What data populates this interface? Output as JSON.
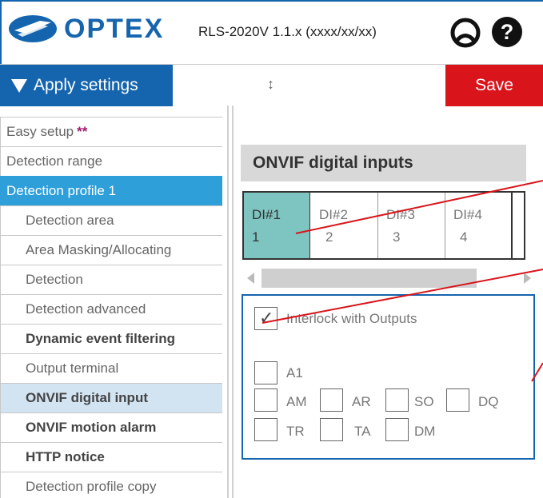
{
  "header": {
    "brand": "OPTEX",
    "version": "RLS-2020V 1.1.x (xxxx/xx/xx)",
    "icons": [
      "profile-icon",
      "help-icon"
    ]
  },
  "toolbar": {
    "apply_label": "Apply settings",
    "resize_glyph": "↕",
    "save_label": "Save"
  },
  "sidebar": {
    "items": [
      {
        "label": "Easy setup",
        "marker": "**"
      },
      {
        "label": "Detection range"
      },
      {
        "label": "Detection profile 1"
      },
      {
        "label": "Detection area"
      },
      {
        "label": "Area Masking/Allocating"
      },
      {
        "label": "Detection"
      },
      {
        "label": "Detection advanced"
      },
      {
        "label": "Dynamic event filtering"
      },
      {
        "label": "Output terminal"
      },
      {
        "label": "ONVIF digital input"
      },
      {
        "label": "ONVIF motion alarm"
      },
      {
        "label": "HTTP notice"
      },
      {
        "label": "Detection profile copy"
      }
    ]
  },
  "main": {
    "title": "ONVIF digital inputs",
    "tabs": [
      {
        "label": "DI#1",
        "value": "1"
      },
      {
        "label": "DI#2",
        "value": "2"
      },
      {
        "label": "DI#3",
        "value": "3"
      },
      {
        "label": "DI#4",
        "value": "4"
      }
    ],
    "interlock": {
      "label": "Interlock with Outputs",
      "checked": true
    },
    "checkboxes": {
      "a1": "A1",
      "am": "AM",
      "ar": "AR",
      "so": "SO",
      "dq": "DQ",
      "tr": "TR",
      "ta": "TA",
      "dm": "DM"
    }
  },
  "colors": {
    "brand_blue": "#1565ae",
    "save_red": "#d9141b",
    "active_nav": "#2e9fd9",
    "selected_nav": "#d2e3f2",
    "active_tab": "#7ec4c1",
    "annotation_red": "#d9141b"
  }
}
